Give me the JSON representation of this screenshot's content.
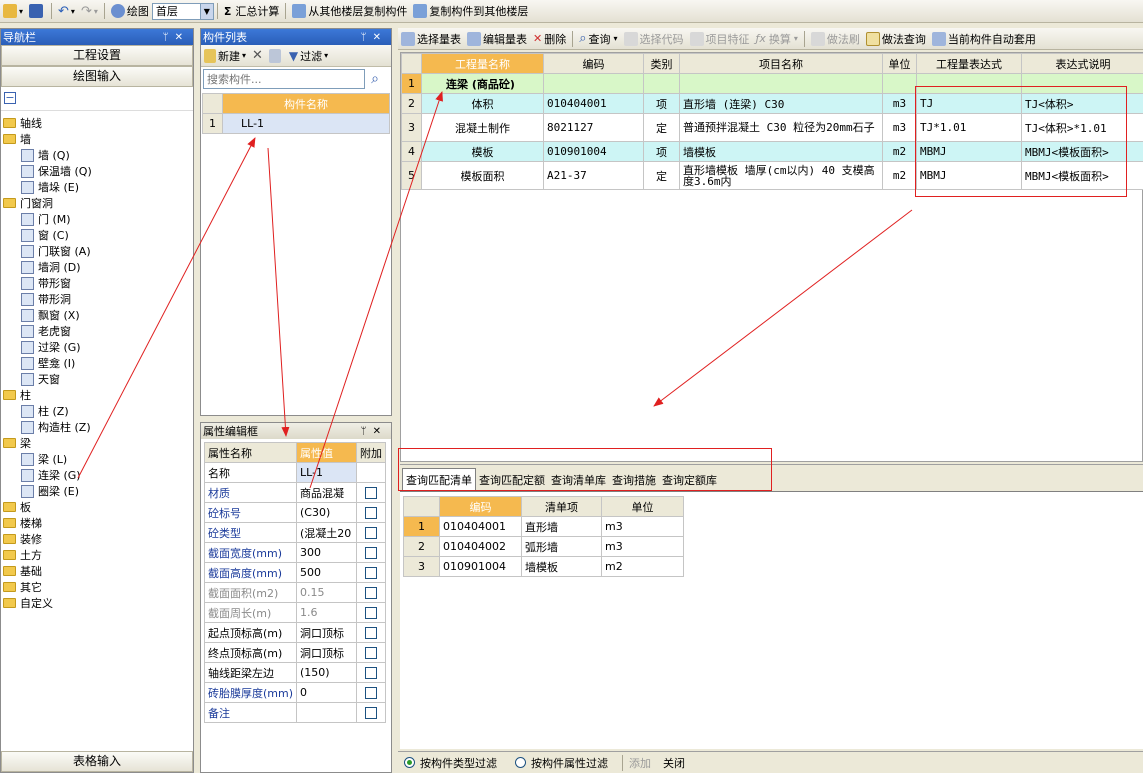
{
  "toolbar": {
    "draw_label": "绘图",
    "floor_value": "首层",
    "sum_label": "汇总计算",
    "copy_from_label": "从其他楼层复制构件",
    "copy_to_label": "复制构件到其他楼层",
    "sigma": "Σ"
  },
  "nav": {
    "title": "导航栏",
    "btn_project": "工程设置",
    "btn_draw": "绘图输入",
    "btn_table": "表格输入",
    "tree": [
      {
        "label": "轴线",
        "level": 0,
        "type": "folder"
      },
      {
        "label": "墙",
        "level": 0,
        "type": "folder"
      },
      {
        "label": "墙 (Q)",
        "level": 1,
        "type": "leaf"
      },
      {
        "label": "保温墙 (Q)",
        "level": 1,
        "type": "leaf"
      },
      {
        "label": "墙垛 (E)",
        "level": 1,
        "type": "leaf"
      },
      {
        "label": "门窗洞",
        "level": 0,
        "type": "folder"
      },
      {
        "label": "门 (M)",
        "level": 1,
        "type": "leaf"
      },
      {
        "label": "窗 (C)",
        "level": 1,
        "type": "leaf"
      },
      {
        "label": "门联窗 (A)",
        "level": 1,
        "type": "leaf"
      },
      {
        "label": "墙洞 (D)",
        "level": 1,
        "type": "leaf"
      },
      {
        "label": "带形窗",
        "level": 1,
        "type": "leaf"
      },
      {
        "label": "带形洞",
        "level": 1,
        "type": "leaf"
      },
      {
        "label": "飘窗 (X)",
        "level": 1,
        "type": "leaf"
      },
      {
        "label": "老虎窗",
        "level": 1,
        "type": "leaf"
      },
      {
        "label": "过梁 (G)",
        "level": 1,
        "type": "leaf"
      },
      {
        "label": "壁龛 (I)",
        "level": 1,
        "type": "leaf"
      },
      {
        "label": "天窗",
        "level": 1,
        "type": "leaf"
      },
      {
        "label": "柱",
        "level": 0,
        "type": "folder"
      },
      {
        "label": "柱 (Z)",
        "level": 1,
        "type": "leaf"
      },
      {
        "label": "构造柱 (Z)",
        "level": 1,
        "type": "leaf"
      },
      {
        "label": "梁",
        "level": 0,
        "type": "folder"
      },
      {
        "label": "梁 (L)",
        "level": 1,
        "type": "leaf"
      },
      {
        "label": "连梁 (G)",
        "level": 1,
        "type": "leaf"
      },
      {
        "label": "圈梁 (E)",
        "level": 1,
        "type": "leaf"
      },
      {
        "label": "板",
        "level": 0,
        "type": "folder"
      },
      {
        "label": "楼梯",
        "level": 0,
        "type": "folder"
      },
      {
        "label": "装修",
        "level": 0,
        "type": "folder"
      },
      {
        "label": "土方",
        "level": 0,
        "type": "folder"
      },
      {
        "label": "基础",
        "level": 0,
        "type": "folder"
      },
      {
        "label": "其它",
        "level": 0,
        "type": "folder"
      },
      {
        "label": "自定义",
        "level": 0,
        "type": "folder"
      }
    ]
  },
  "comp": {
    "title": "构件列表",
    "new_label": "新建",
    "filter_label": "过滤",
    "search_placeholder": "搜索构件...",
    "col_name": "构件名称",
    "rows": [
      {
        "num": "1",
        "name": "LL-1"
      }
    ]
  },
  "prop": {
    "title": "属性编辑框",
    "col_name": "属性名称",
    "col_value": "属性值",
    "col_add": "附加",
    "rows": [
      {
        "name": "名称",
        "value": "LL-1",
        "blue": false,
        "gray": false,
        "check": false
      },
      {
        "name": "材质",
        "value": "商品混凝",
        "blue": true,
        "gray": false,
        "check": true
      },
      {
        "name": "砼标号",
        "value": "(C30)",
        "blue": true,
        "gray": false,
        "check": true
      },
      {
        "name": "砼类型",
        "value": "(混凝土20",
        "blue": true,
        "gray": false,
        "check": true
      },
      {
        "name": "截面宽度(mm)",
        "value": "300",
        "blue": true,
        "gray": false,
        "check": true
      },
      {
        "name": "截面高度(mm)",
        "value": "500",
        "blue": true,
        "gray": false,
        "check": true
      },
      {
        "name": "截面面积(m2)",
        "value": "0.15",
        "blue": false,
        "gray": true,
        "check": true
      },
      {
        "name": "截面周长(m)",
        "value": "1.6",
        "blue": false,
        "gray": true,
        "check": true
      },
      {
        "name": "起点顶标高(m)",
        "value": "洞口顶标",
        "blue": false,
        "gray": false,
        "check": true
      },
      {
        "name": "终点顶标高(m)",
        "value": "洞口顶标",
        "blue": false,
        "gray": false,
        "check": true
      },
      {
        "name": "轴线距梁左边",
        "value": "(150)",
        "blue": false,
        "gray": false,
        "check": true
      },
      {
        "name": "砖胎膜厚度(mm)",
        "value": "0",
        "blue": true,
        "gray": false,
        "check": true
      },
      {
        "name": "备注",
        "value": "",
        "blue": true,
        "gray": false,
        "check": true
      }
    ]
  },
  "main": {
    "tb": {
      "select_list": "选择量表",
      "edit_list": "编辑量表",
      "delete": "删除",
      "query": "查询",
      "select_code": "选择代码",
      "item_feature": "项目特征",
      "convert": "换算",
      "method_brush": "做法刷",
      "method_query": "做法查询",
      "auto_apply": "当前构件自动套用"
    },
    "cols": [
      "工程量名称",
      "编码",
      "类别",
      "项目名称",
      "单位",
      "工程量表达式",
      "表达式说明"
    ],
    "rows": [
      {
        "num": "1",
        "name": "连梁 (商品砼)",
        "code": "",
        "cat": "",
        "proj": "",
        "unit": "",
        "expr": "",
        "desc": "",
        "style": "group"
      },
      {
        "num": "2",
        "name": "体积",
        "code": "010404001",
        "cat": "项",
        "proj": "直形墙 (连梁) C30",
        "unit": "m3",
        "expr": "TJ",
        "desc": "TJ<体积>",
        "style": "item"
      },
      {
        "num": "3",
        "name": "混凝土制作",
        "code": "8021127",
        "cat": "定",
        "proj": "普通预拌混凝土 C30 粒径为20mm石子",
        "unit": "m3",
        "expr": "TJ*1.01",
        "desc": "TJ<体积>*1.01",
        "style": "quota"
      },
      {
        "num": "4",
        "name": "模板",
        "code": "010901004",
        "cat": "项",
        "proj": "墙模板",
        "unit": "m2",
        "expr": "MBMJ",
        "desc": "MBMJ<模板面积>",
        "style": "item"
      },
      {
        "num": "5",
        "name": "模板面积",
        "code": "A21-37",
        "cat": "定",
        "proj": "直形墙模板 墙厚(cm以内) 40 支模高度3.6m内",
        "unit": "m2",
        "expr": "MBMJ",
        "desc": "MBMJ<模板面积>",
        "style": "quota"
      }
    ],
    "tabs": [
      "查询匹配清单",
      "查询匹配定额",
      "查询清单库",
      "查询措施",
      "查询定额库"
    ],
    "sub_cols": [
      "编码",
      "清单项",
      "单位"
    ],
    "sub_rows": [
      {
        "num": "1",
        "code": "010404001",
        "item": "直形墙",
        "unit": "m3"
      },
      {
        "num": "2",
        "code": "010404002",
        "item": "弧形墙",
        "unit": "m3"
      },
      {
        "num": "3",
        "code": "010901004",
        "item": "墙模板",
        "unit": "m2"
      }
    ],
    "filter_type": "按构件类型过滤",
    "filter_attr": "按构件属性过滤",
    "btn_add": "添加",
    "btn_close": "关闭"
  },
  "colors": {
    "accent": "#2a5eb8",
    "header_orange": "#f5b94f",
    "annot_red": "#e02020",
    "row_cyan": "#cdf5f5",
    "row_green": "#d8f7c8"
  }
}
